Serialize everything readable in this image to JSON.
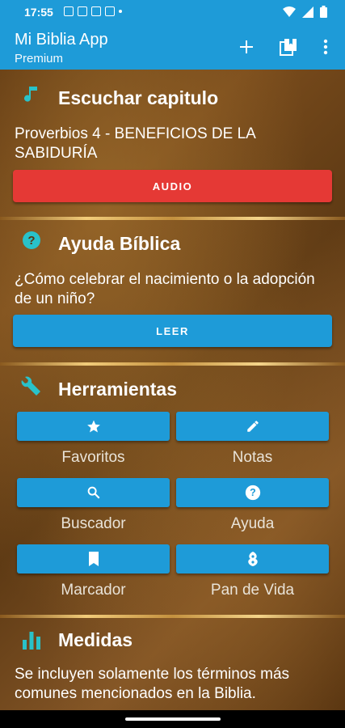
{
  "status_bar": {
    "time": "17:55",
    "icons": [
      "notification-icon",
      "sim-icon",
      "image-icon",
      "gallery-icon",
      "dot-icon",
      "wifi-icon",
      "signal-icon",
      "battery-icon"
    ]
  },
  "app_bar": {
    "title": "Mi Biblia App",
    "subtitle": "Premium",
    "actions": [
      "add-icon",
      "library-icon",
      "more-vert-icon"
    ]
  },
  "listen": {
    "icon": "music-note-icon",
    "title": "Escuchar capitulo",
    "text": "Proverbios 4 - BENEFICIOS DE LA SABIDURÍA",
    "button_label": "AUDIO"
  },
  "help": {
    "icon": "help-circle-icon",
    "title": "Ayuda Bíblica",
    "text": "¿Cómo celebrar el nacimiento o la adopción de un niño?",
    "button_label": "LEER"
  },
  "tools": {
    "icon": "wrench-icon",
    "title": "Herramientas",
    "items": [
      {
        "label": "Favoritos",
        "icon": "star-icon"
      },
      {
        "label": "Notas",
        "icon": "pencil-icon"
      },
      {
        "label": "Buscador",
        "icon": "search-icon"
      },
      {
        "label": "Ayuda",
        "icon": "help-icon"
      },
      {
        "label": "Marcador",
        "icon": "bookmark-icon"
      },
      {
        "label": "Pan de Vida",
        "icon": "bread-icon"
      }
    ]
  },
  "measures": {
    "icon": "bar-chart-icon",
    "title": "Medidas",
    "text": "Se incluyen solamente los términos más comunes mencionados en la Biblia."
  },
  "colors": {
    "accent": "#1e9bd8",
    "audio_button": "#e53935",
    "section_icon": "#29c2c9",
    "wood": "#6b4218"
  }
}
